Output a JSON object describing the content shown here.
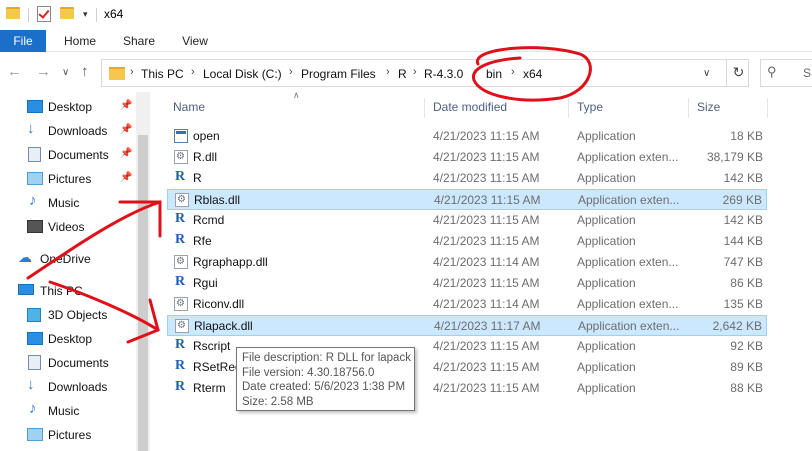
{
  "window": {
    "title": "x64"
  },
  "ribbon": {
    "tabs": [
      {
        "label": "File"
      },
      {
        "label": "Home"
      },
      {
        "label": "Share"
      },
      {
        "label": "View"
      }
    ]
  },
  "address": {
    "crumbs": [
      "This PC",
      "Local Disk (C:)",
      "Program Files",
      "R",
      "R-4.3.0",
      "bin",
      "x64"
    ],
    "search_placeholder": "S"
  },
  "nav_pane": {
    "quick_access": [
      {
        "label": "Desktop",
        "icon": "desktop-icon",
        "pinned": true
      },
      {
        "label": "Downloads",
        "icon": "download-arrow-icon",
        "pinned": true
      },
      {
        "label": "Documents",
        "icon": "documents-icon",
        "pinned": true
      },
      {
        "label": "Pictures",
        "icon": "pictures-icon",
        "pinned": true
      },
      {
        "label": "Music",
        "icon": "music-note-icon",
        "pinned": false
      },
      {
        "label": "Videos",
        "icon": "videos-icon",
        "pinned": false
      }
    ],
    "onedrive": {
      "label": "OneDrive",
      "icon": "cloud-icon"
    },
    "this_pc": {
      "label": "This PC",
      "icon": "computer-icon"
    },
    "this_pc_items": [
      {
        "label": "3D Objects",
        "icon": "cube-icon"
      },
      {
        "label": "Desktop",
        "icon": "desktop-icon"
      },
      {
        "label": "Documents",
        "icon": "documents-icon"
      },
      {
        "label": "Downloads",
        "icon": "download-arrow-icon"
      },
      {
        "label": "Music",
        "icon": "music-note-icon"
      },
      {
        "label": "Pictures",
        "icon": "pictures-icon"
      }
    ]
  },
  "columns": {
    "name": "Name",
    "date": "Date modified",
    "type": "Type",
    "size": "Size"
  },
  "files": [
    {
      "name": "open",
      "date": "4/21/2023 11:15 AM",
      "type": "Application",
      "size": "18 KB",
      "icon": "exe",
      "selected": false
    },
    {
      "name": "R.dll",
      "date": "4/21/2023 11:15 AM",
      "type": "Application exten...",
      "size": "38,179 KB",
      "icon": "dll",
      "selected": false
    },
    {
      "name": "R",
      "date": "4/21/2023 11:15 AM",
      "type": "Application",
      "size": "142 KB",
      "icon": "r",
      "selected": false
    },
    {
      "name": "Rblas.dll",
      "date": "4/21/2023 11:15 AM",
      "type": "Application exten...",
      "size": "269 KB",
      "icon": "dll",
      "selected": true
    },
    {
      "name": "Rcmd",
      "date": "4/21/2023 11:15 AM",
      "type": "Application",
      "size": "142 KB",
      "icon": "r",
      "selected": false
    },
    {
      "name": "Rfe",
      "date": "4/21/2023 11:15 AM",
      "type": "Application",
      "size": "144 KB",
      "icon": "r",
      "selected": false
    },
    {
      "name": "Rgraphapp.dll",
      "date": "4/21/2023 11:14 AM",
      "type": "Application exten...",
      "size": "747 KB",
      "icon": "dll",
      "selected": false
    },
    {
      "name": "Rgui",
      "date": "4/21/2023 11:15 AM",
      "type": "Application",
      "size": "86 KB",
      "icon": "r",
      "selected": false
    },
    {
      "name": "Riconv.dll",
      "date": "4/21/2023 11:14 AM",
      "type": "Application exten...",
      "size": "135 KB",
      "icon": "dll",
      "selected": false
    },
    {
      "name": "Rlapack.dll",
      "date": "4/21/2023 11:17 AM",
      "type": "Application exten...",
      "size": "2,642 KB",
      "icon": "dll",
      "selected": true
    },
    {
      "name": "Rscript",
      "date": "4/21/2023 11:15 AM",
      "type": "Application",
      "size": "92 KB",
      "icon": "r",
      "selected": false
    },
    {
      "name": "RSetReg",
      "date": "4/21/2023 11:15 AM",
      "type": "Application",
      "size": "89 KB",
      "icon": "r",
      "selected": false
    },
    {
      "name": "Rterm",
      "date": "4/21/2023 11:15 AM",
      "type": "Application",
      "size": "88 KB",
      "icon": "r",
      "selected": false
    }
  ],
  "tooltip": {
    "lines": [
      "File description: R DLL for lapack",
      "File version: 4.30.18756.0",
      "Date created: 5/6/2023 1:38 PM",
      "Size: 2.58 MB"
    ]
  },
  "colors": {
    "accent": "#1a6fc9",
    "selection": "#cce8ff",
    "annotation": "#e0101a"
  }
}
